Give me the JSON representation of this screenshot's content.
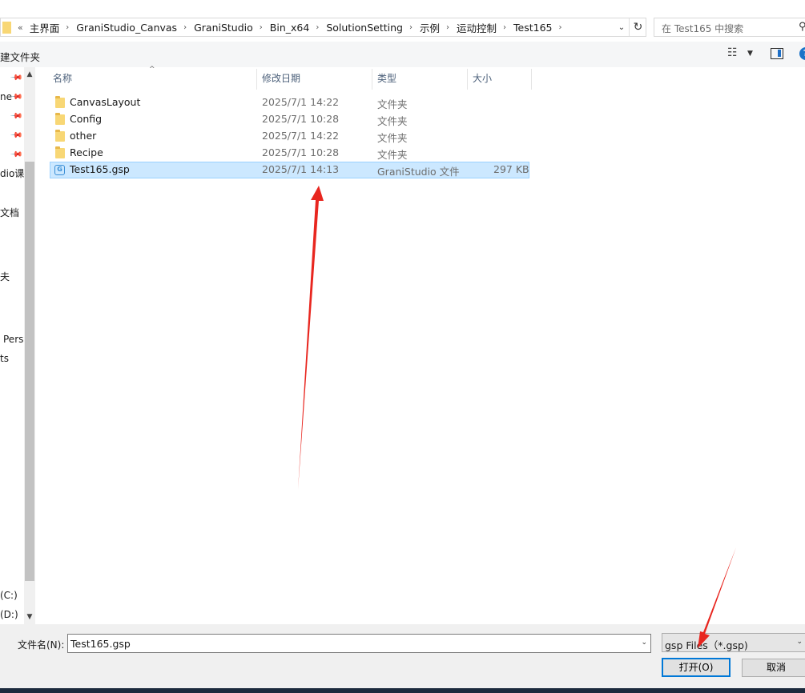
{
  "address": {
    "overflow": "«",
    "crumbs": [
      "主界面",
      "GraniStudio_Canvas",
      "GraniStudio",
      "Bin_x64",
      "SolutionSetting",
      "示例",
      "运动控制",
      "Test165"
    ]
  },
  "search": {
    "placeholder": "在 Test165 中搜索"
  },
  "toolbar": {
    "new_folder": "建文件夹"
  },
  "nav": {
    "items": [
      {
        "label": "ne"
      },
      {
        "label": "dio课"
      },
      {
        "label": "文档"
      },
      {
        "label": "夫"
      },
      {
        "label": "Pers"
      },
      {
        "label": "ts"
      },
      {
        "label": "(C:)"
      },
      {
        "label": "(D:)"
      }
    ]
  },
  "columns": {
    "name": "名称",
    "date": "修改日期",
    "type": "类型",
    "size": "大小"
  },
  "files": [
    {
      "name": "CanvasLayout",
      "date": "2025/7/1 14:22",
      "type": "文件夹",
      "size": "",
      "icon": "folder-icon"
    },
    {
      "name": "Config",
      "date": "2025/7/1 10:28",
      "type": "文件夹",
      "size": "",
      "icon": "folder-icon"
    },
    {
      "name": "other",
      "date": "2025/7/1 14:22",
      "type": "文件夹",
      "size": "",
      "icon": "folder-icon"
    },
    {
      "name": "Recipe",
      "date": "2025/7/1 10:28",
      "type": "文件夹",
      "size": "",
      "icon": "folder-icon"
    },
    {
      "name": "Test165.gsp",
      "date": "2025/7/1 14:13",
      "type": "GraniStudio 文件",
      "size": "297 KB",
      "icon": "gsp-file-icon",
      "selected": true
    }
  ],
  "footer": {
    "filename_label": "文件名(N):",
    "filename_value": "Test165.gsp",
    "filetype_value": "gsp Files（*.gsp)",
    "open_label": "打开(O)",
    "cancel_label": "取消"
  },
  "colors": {
    "selection": "#cce8ff",
    "accent": "#0078d7",
    "annotation_arrow": "#e8261f"
  }
}
